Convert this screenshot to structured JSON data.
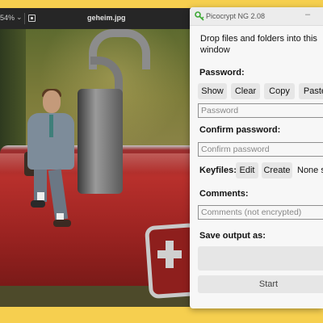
{
  "viewer": {
    "zoom": "54%",
    "filename": "geheim.jpg"
  },
  "picocrypt": {
    "title": "Picocrypt NG 2.08",
    "drop_text": "Drop files and folders into this window",
    "password_label": "Password:",
    "buttons": {
      "show": "Show",
      "clear": "Clear",
      "copy": "Copy",
      "paste": "Paste"
    },
    "password_placeholder": "Password",
    "confirm_label": "Confirm password:",
    "confirm_placeholder": "Confirm password",
    "keyfiles_label": "Keyfiles:",
    "keyfiles_edit": "Edit",
    "keyfiles_create": "Create",
    "keyfiles_status": "None selected",
    "comments_label": "Comments:",
    "comments_placeholder": "Comments (not encrypted)",
    "save_label": "Save output as:",
    "start_label": "Start",
    "accent_color": "#3aa832"
  }
}
